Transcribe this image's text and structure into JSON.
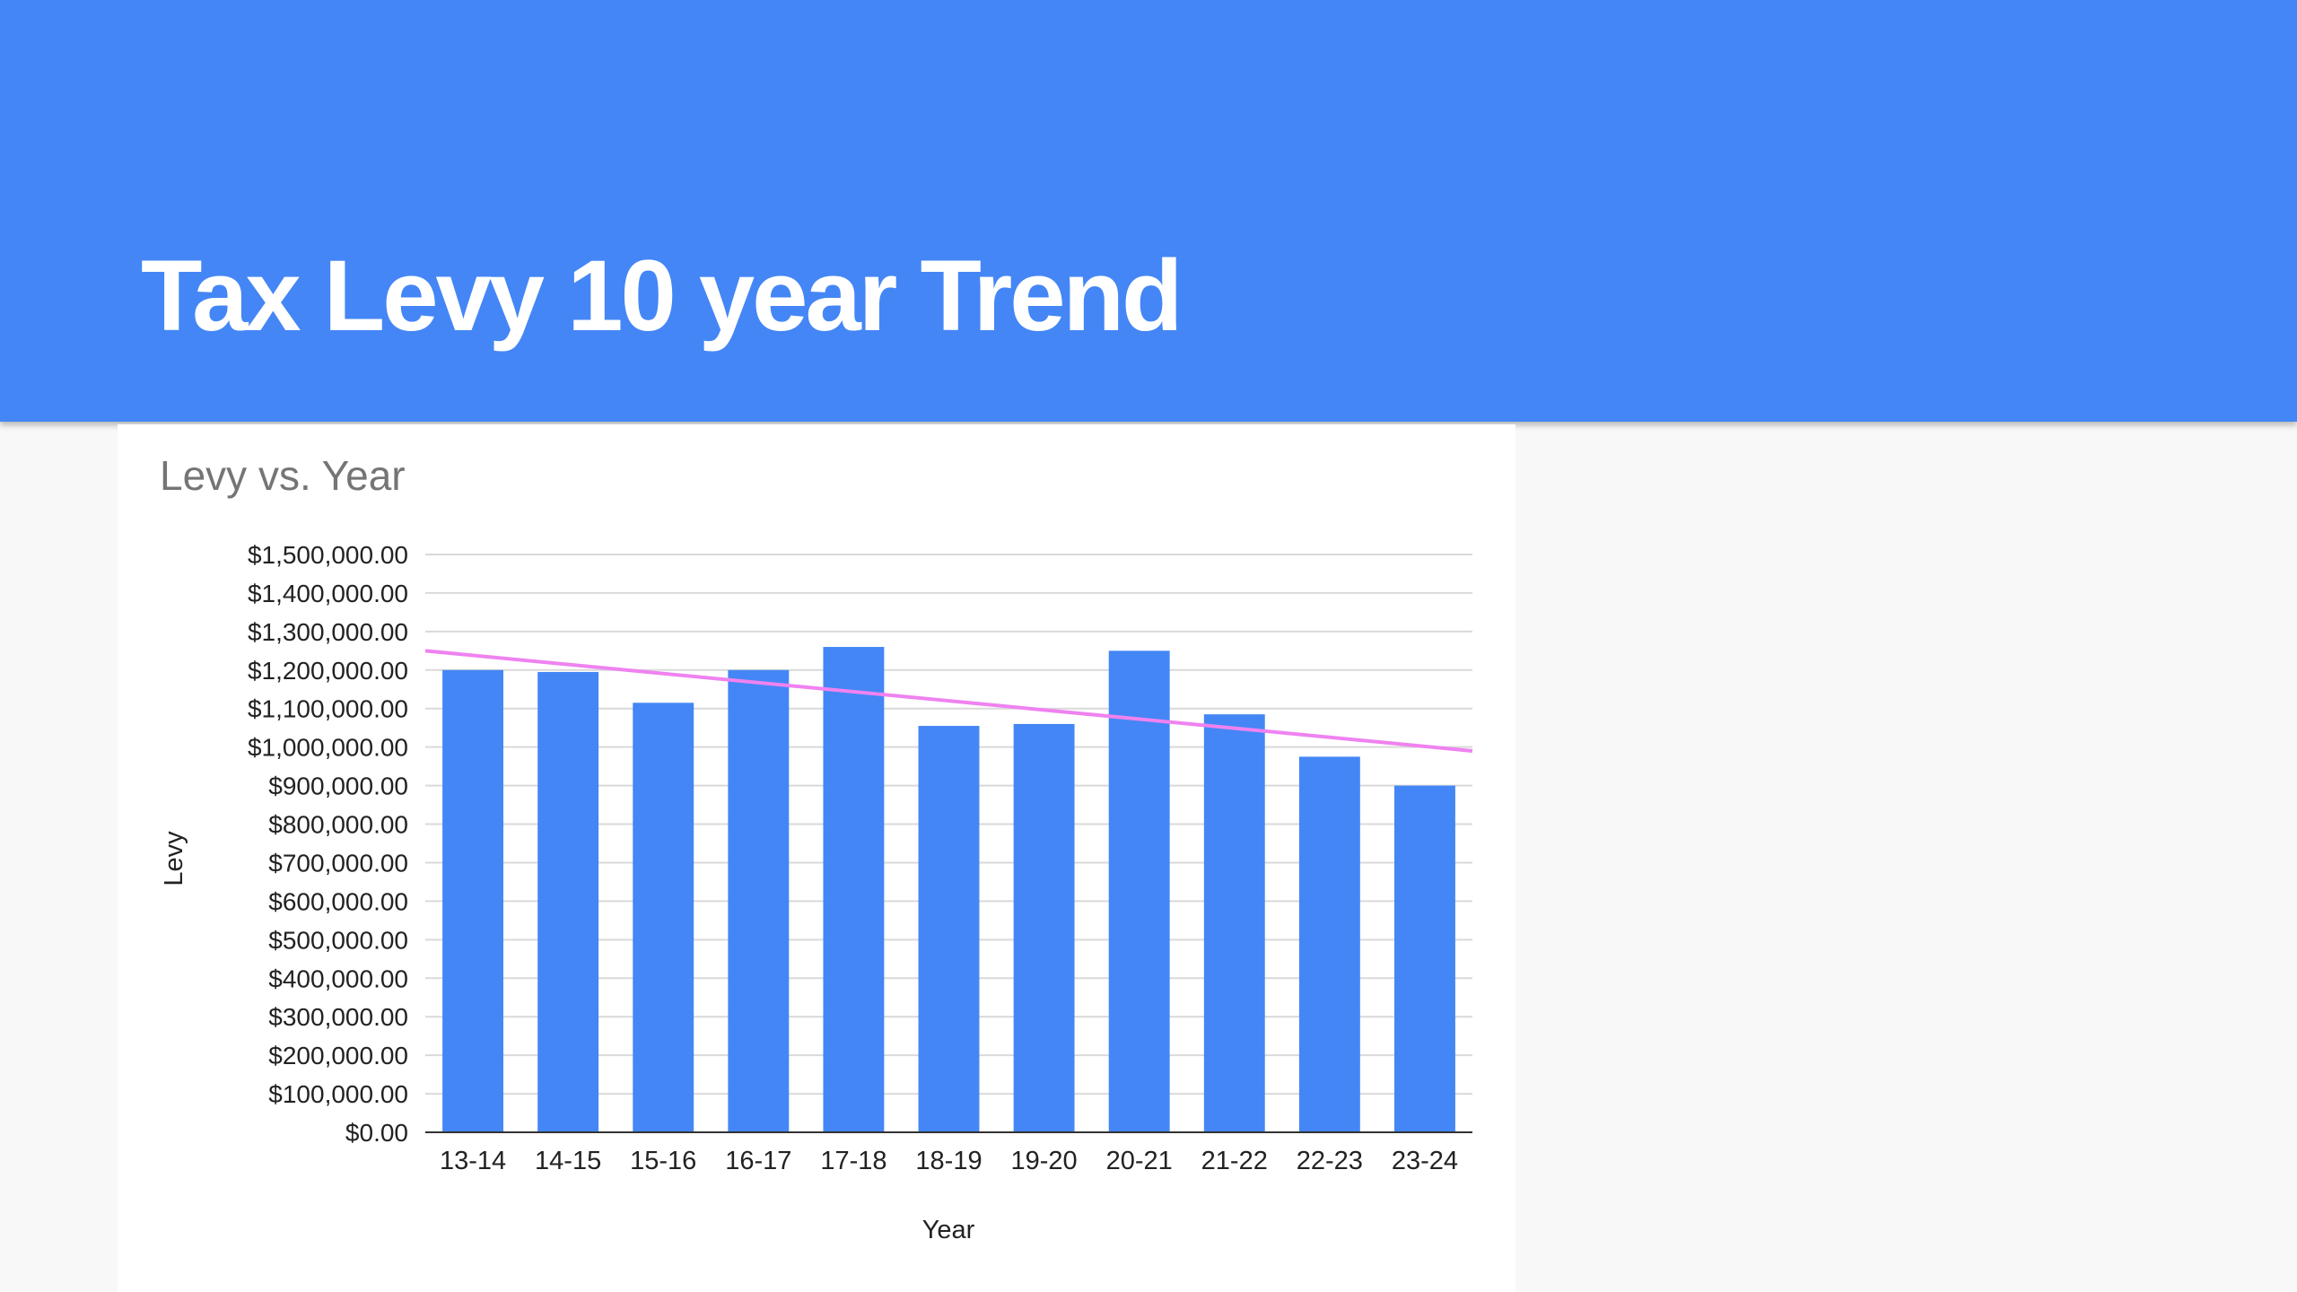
{
  "slide": {
    "title": "Tax Levy 10 year Trend"
  },
  "colors": {
    "header": "#4486f5",
    "bar": "#4486f5",
    "trendline": "#ef82f0",
    "background": "#f8f8f8",
    "card": "#ffffff"
  },
  "chart_data": {
    "type": "bar",
    "title": "Levy vs. Year",
    "xlabel": "Year",
    "ylabel": "Levy",
    "categories": [
      "13-14",
      "14-15",
      "15-16",
      "16-17",
      "17-18",
      "18-19",
      "19-20",
      "20-21",
      "21-22",
      "22-23",
      "23-24"
    ],
    "series": [
      {
        "values": [
          1200000,
          1195000,
          1115000,
          1200000,
          1260000,
          1055000,
          1060000,
          1250000,
          1085000,
          975000,
          900000
        ]
      }
    ],
    "trendline": {
      "type": "linear",
      "start": 1250000,
      "end": 990000
    },
    "ylim": [
      0,
      1500000
    ],
    "yticks": [
      0,
      100000,
      200000,
      300000,
      400000,
      500000,
      600000,
      700000,
      800000,
      900000,
      1000000,
      1100000,
      1200000,
      1300000,
      1400000,
      1500000
    ],
    "ytick_labels": [
      "$0.00",
      "$100,000.00",
      "$200,000.00",
      "$300,000.00",
      "$400,000.00",
      "$500,000.00",
      "$600,000.00",
      "$700,000.00",
      "$800,000.00",
      "$900,000.00",
      "$1,000,000.00",
      "$1,100,000.00",
      "$1,200,000.00",
      "$1,300,000.00",
      "$1,400,000.00",
      "$1,500,000.00"
    ],
    "grid": true,
    "legend": "none"
  }
}
